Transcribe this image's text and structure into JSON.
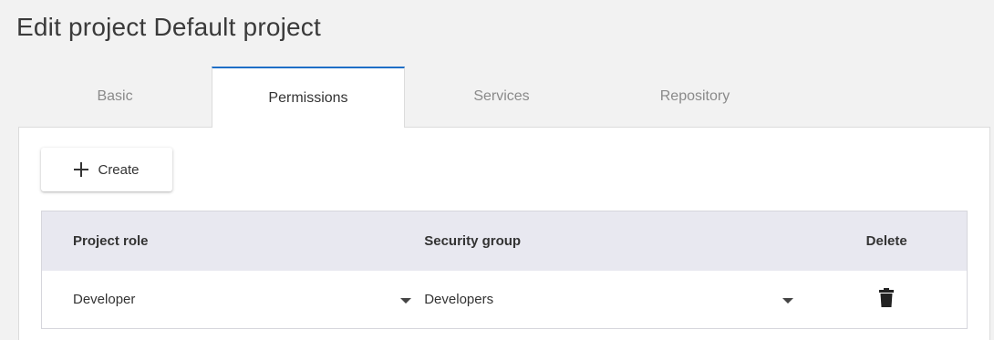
{
  "page": {
    "title": "Edit project Default project"
  },
  "tabs": [
    {
      "label": "Basic",
      "active": false
    },
    {
      "label": "Permissions",
      "active": true
    },
    {
      "label": "Services",
      "active": false
    },
    {
      "label": "Repository",
      "active": false
    }
  ],
  "toolbar": {
    "create_label": "Create",
    "create_icon": "plus-icon"
  },
  "table": {
    "headers": {
      "role": "Project role",
      "group": "Security group",
      "delete": "Delete"
    },
    "rows": [
      {
        "role": "Developer",
        "group": "Developers",
        "delete_icon": "trash-icon"
      }
    ]
  },
  "colors": {
    "accent": "#1f6fc6",
    "header_bg": "#e8e8f0",
    "page_bg": "#f2f2f2"
  }
}
